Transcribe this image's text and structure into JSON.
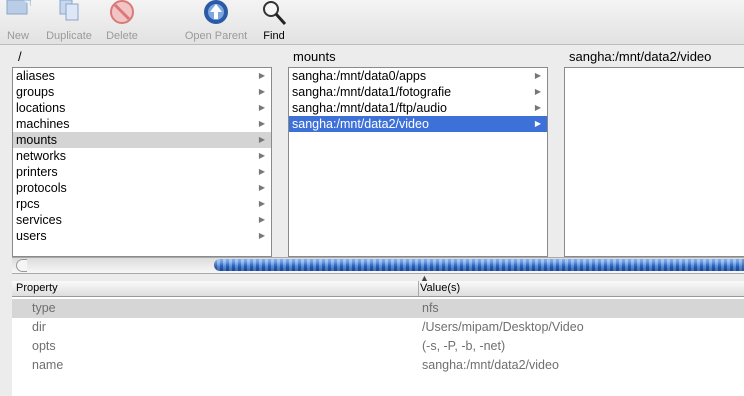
{
  "toolbar": {
    "buttons": [
      {
        "label": "New",
        "icon": "new-folder-icon",
        "enabled": false
      },
      {
        "label": "Duplicate",
        "icon": "duplicate-icon",
        "enabled": false
      },
      {
        "label": "Delete",
        "icon": "delete-icon",
        "enabled": false
      },
      {
        "label": "Open Parent",
        "icon": "open-parent-icon",
        "enabled": false
      },
      {
        "label": "Find",
        "icon": "magnifier-icon",
        "enabled": true
      }
    ]
  },
  "path": {
    "col1": "/",
    "col2": "mounts",
    "col3": "sangha:/mnt/data2/video"
  },
  "columns": {
    "col1": [
      "aliases",
      "groups",
      "locations",
      "machines",
      "mounts",
      "networks",
      "printers",
      "protocols",
      "rpcs",
      "services",
      "users"
    ],
    "col1_selected": "mounts",
    "col2": [
      "sangha:/mnt/data0/apps",
      "sangha:/mnt/data1/fotografie",
      "sangha:/mnt/data1/ftp/audio",
      "sangha:/mnt/data2/video"
    ],
    "col2_selected": "sangha:/mnt/data2/video"
  },
  "table": {
    "header_property": "Property",
    "header_values": "Value(s)",
    "rows": [
      {
        "property": "type",
        "value": "nfs"
      },
      {
        "property": "dir",
        "value": "/Users/mipam/Desktop/Video"
      },
      {
        "property": "opts",
        "value": "(-s, -P, -b, -net)"
      },
      {
        "property": "name",
        "value": "sangha:/mnt/data2/video"
      }
    ]
  },
  "colors": {
    "selection_blue": "#3d71d8",
    "selection_gray": "#d4d4d4",
    "scroll_thumb": "#2a6ccc"
  }
}
